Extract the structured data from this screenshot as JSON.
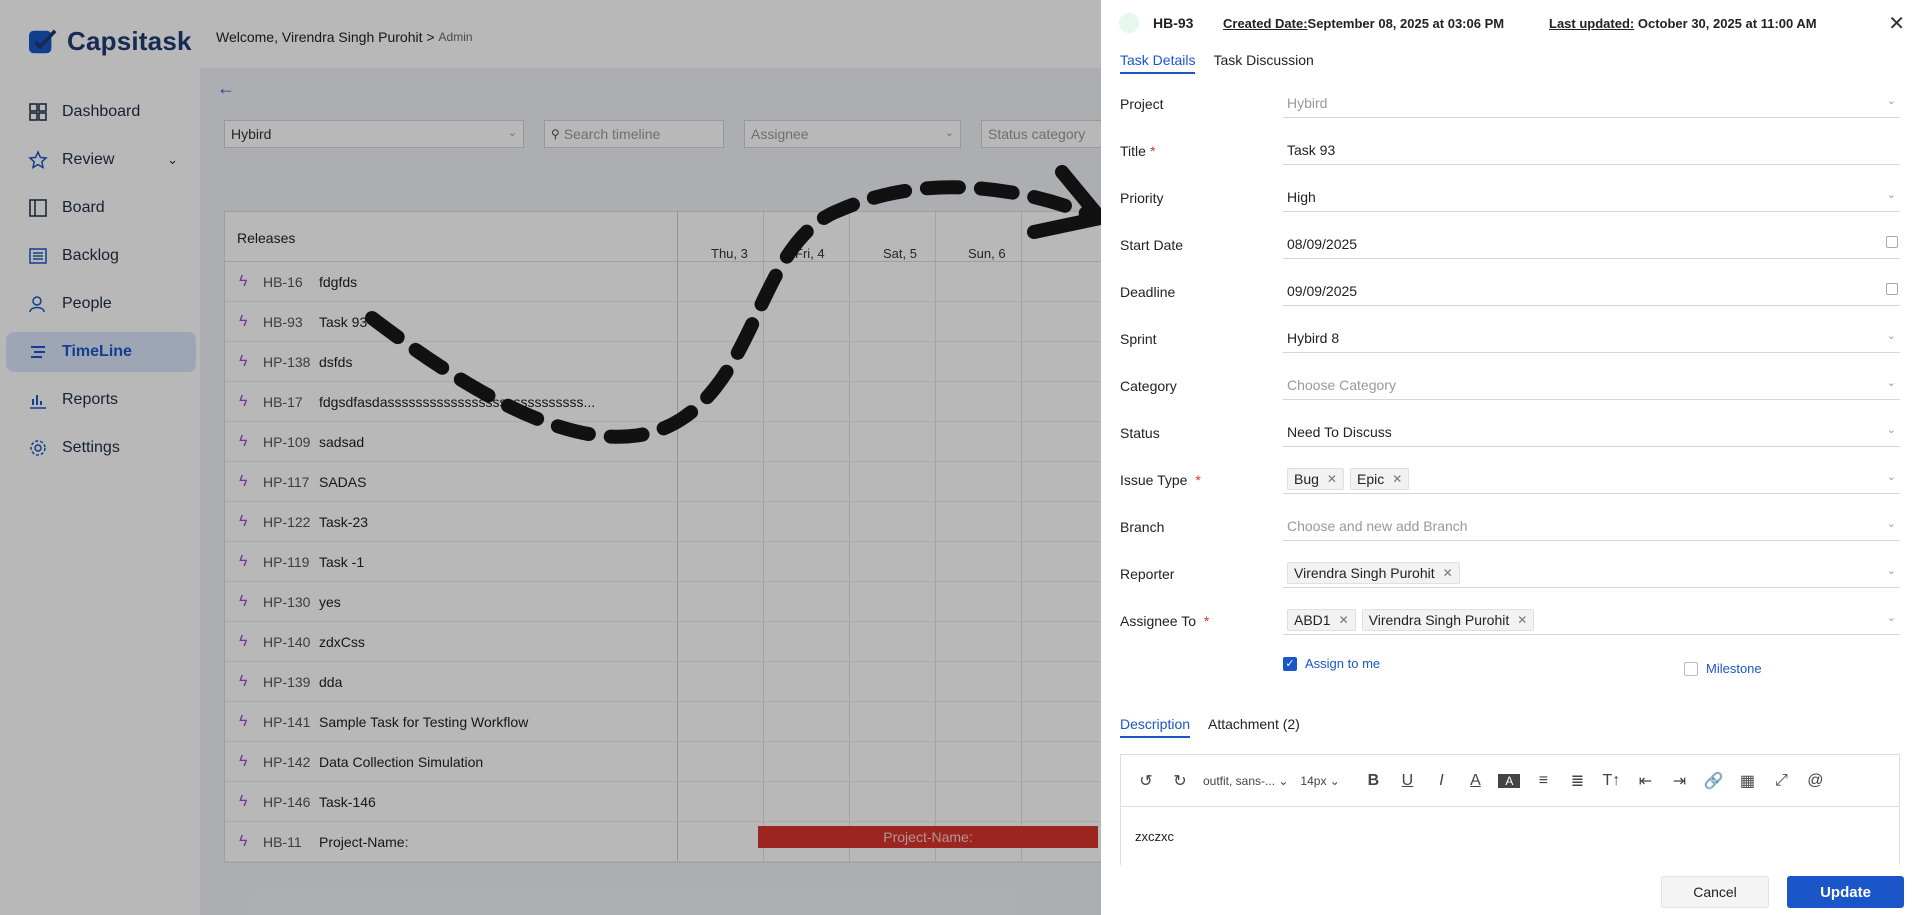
{
  "app": {
    "brand": "Capsitask",
    "welcome": "Welcome, Virendra Singh Purohit >",
    "role": "Admin"
  },
  "nav": [
    {
      "label": "Dashboard",
      "icon": "grid-icon"
    },
    {
      "label": "Review",
      "icon": "star-icon"
    },
    {
      "label": "Board",
      "icon": "board-icon"
    },
    {
      "label": "Backlog",
      "icon": "list-icon"
    },
    {
      "label": "People",
      "icon": "people-icon"
    },
    {
      "label": "TimeLine",
      "icon": "timeline-icon"
    },
    {
      "label": "Reports",
      "icon": "bar-chart-icon"
    },
    {
      "label": "Settings",
      "icon": "gear-icon"
    }
  ],
  "filters": {
    "project": "Hybird",
    "search_placeholder": "Search timeline",
    "assignee_placeholder": "Assignee",
    "status_placeholder": "Status category"
  },
  "timeline": {
    "header": "Releases",
    "days": [
      "Thu, 3",
      "Fri, 4",
      "Sat, 5",
      "Sun, 6"
    ],
    "rows": [
      {
        "code": "HB-16",
        "name": "fdgfds"
      },
      {
        "code": "HB-93",
        "name": "Task 93"
      },
      {
        "code": "HP-138",
        "name": "dsfds"
      },
      {
        "code": "HB-17",
        "name": "fdgsdfasdassssssssssssssssssssssssssss..."
      },
      {
        "code": "HP-109",
        "name": "sadsad"
      },
      {
        "code": "HP-117",
        "name": "SADAS"
      },
      {
        "code": "HP-122",
        "name": "Task-23"
      },
      {
        "code": "HP-119",
        "name": "Task -1"
      },
      {
        "code": "HP-130",
        "name": "yes"
      },
      {
        "code": "HP-140",
        "name": "zdxCss"
      },
      {
        "code": "HP-139",
        "name": "dda"
      },
      {
        "code": "HP-141",
        "name": "Sample Task for Testing Workflow"
      },
      {
        "code": "HP-142",
        "name": "Data Collection Simulation"
      },
      {
        "code": "HP-146",
        "name": "Task-146"
      },
      {
        "code": "HB-11",
        "name": "Project-Name:"
      }
    ],
    "bar_label": "Project-Name:",
    "bar_color": "#d9352b"
  },
  "drawer": {
    "task_id": "HB-93",
    "created_label": "Created Date:",
    "created_value": "September 08, 2025 at 03:06 PM",
    "updated_label": "Last updated:",
    "updated_value": "October 30, 2025 at 11:00 AM",
    "tabs": [
      "Task Details",
      "Task Discussion"
    ],
    "fields": {
      "project": {
        "label": "Project",
        "value": "Hybird"
      },
      "title": {
        "label": "Title",
        "value": "Task 93"
      },
      "priority": {
        "label": "Priority",
        "value": "High"
      },
      "start_date": {
        "label": "Start Date",
        "value": "08/09/2025"
      },
      "deadline": {
        "label": "Deadline",
        "value": "09/09/2025"
      },
      "sprint": {
        "label": "Sprint",
        "value": "Hybird 8"
      },
      "category": {
        "label": "Category",
        "placeholder": "Choose Category"
      },
      "status": {
        "label": "Status",
        "value": "Need To Discuss"
      },
      "issue_type": {
        "label": "Issue Type",
        "chips": [
          "Bug",
          "Epic"
        ]
      },
      "branch": {
        "label": "Branch",
        "placeholder": "Choose and new add Branch"
      },
      "reporter": {
        "label": "Reporter",
        "chips": [
          "Virendra Singh Purohit"
        ]
      },
      "assignee": {
        "label": "Assignee To",
        "chips": [
          "ABD1",
          "Virendra Singh Purohit"
        ]
      }
    },
    "assign_to_me": "Assign to me",
    "milestone": "Milestone",
    "desc_tabs": [
      "Description",
      "Attachment (2)"
    ],
    "editor": {
      "font": "outfit, sans-...",
      "size": "14px",
      "content": "zxczxc"
    },
    "cancel": "Cancel",
    "update": "Update"
  },
  "colors": {
    "accent": "#1a56c8",
    "danger": "#d9352b",
    "brand": "#1f3b73"
  }
}
